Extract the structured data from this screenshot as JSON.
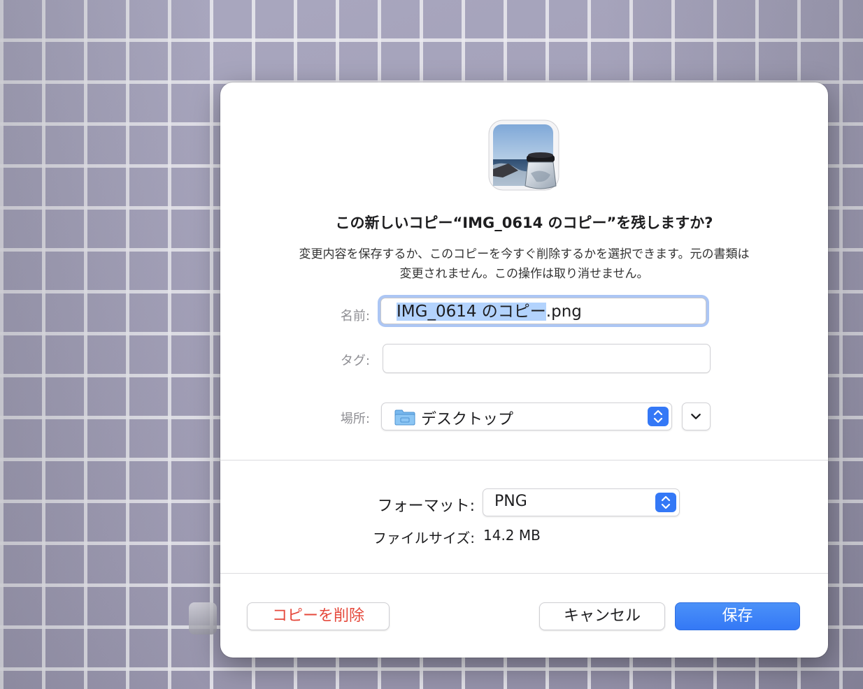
{
  "dialog": {
    "title": "この新しいコピー“IMG_0614 のコピー”を残しますか?",
    "message_line1": "変更内容を保存するか、このコピーを今すぐ削除するかを選択できます。元の書類は",
    "message_line2": "変更されません。この操作は取り消せません。",
    "app_icon": "preview-app-icon"
  },
  "form": {
    "name_label": "名前:",
    "name_selected": "IMG_0614 のコピー",
    "name_extension": ".png",
    "tag_label": "タグ:",
    "tag_value": "",
    "location_label": "場所:",
    "location_value": "デスクトップ",
    "location_icon": "folder-icon"
  },
  "export": {
    "format_label": "フォーマット:",
    "format_value": "PNG",
    "filesize_label": "ファイルサイズ:",
    "filesize_value": "14.2 MB"
  },
  "buttons": {
    "delete_label": "コピーを削除",
    "cancel_label": "キャンセル",
    "save_label": "保存"
  },
  "colors": {
    "accent": "#3478f6",
    "destructive": "#e5483b",
    "selection": "#b3d3fd",
    "background_tile": "#a9a7bd"
  }
}
